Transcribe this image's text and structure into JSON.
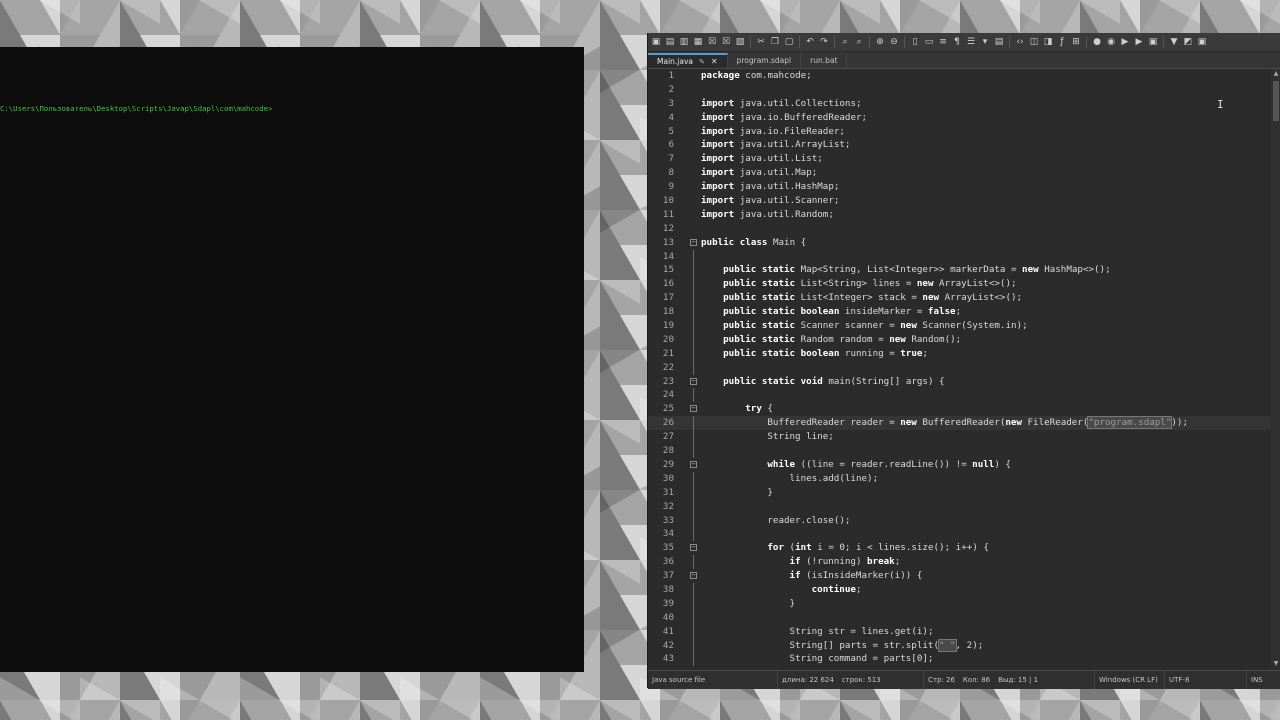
{
  "console": {
    "prompt": "C:\\Users\\Пользователь\\Desktop\\Scripts\\Javap\\Sdapl\\com\\mahcode>"
  },
  "editor": {
    "tabs": [
      {
        "label": "Main.java",
        "active": true
      },
      {
        "label": "program.sdapl",
        "active": false
      },
      {
        "label": "run.bat",
        "active": false
      }
    ],
    "lines": [
      {
        "n": "1",
        "text": "package com.mahcode;"
      },
      {
        "n": "2",
        "text": ""
      },
      {
        "n": "3",
        "text": "import java.util.Collections;"
      },
      {
        "n": "4",
        "text": "import java.io.BufferedReader;"
      },
      {
        "n": "5",
        "text": "import java.io.FileReader;"
      },
      {
        "n": "6",
        "text": "import java.util.ArrayList;"
      },
      {
        "n": "7",
        "text": "import java.util.List;"
      },
      {
        "n": "8",
        "text": "import java.util.Map;"
      },
      {
        "n": "9",
        "text": "import java.util.HashMap;"
      },
      {
        "n": "10",
        "text": "import java.util.Scanner;"
      },
      {
        "n": "11",
        "text": "import java.util.Random;"
      },
      {
        "n": "12",
        "text": ""
      },
      {
        "n": "13",
        "text": "public class Main {",
        "fold": true
      },
      {
        "n": "14",
        "text": ""
      },
      {
        "n": "15",
        "text": "    public static Map<String, List<Integer>> markerData = new HashMap<>();"
      },
      {
        "n": "16",
        "text": "    public static List<String> lines = new ArrayList<>();"
      },
      {
        "n": "17",
        "text": "    public static List<Integer> stack = new ArrayList<>();"
      },
      {
        "n": "18",
        "text": "    public static boolean insideMarker = false;"
      },
      {
        "n": "19",
        "text": "    public static Scanner scanner = new Scanner(System.in);"
      },
      {
        "n": "20",
        "text": "    public static Random random = new Random();"
      },
      {
        "n": "21",
        "text": "    public static boolean running = true;"
      },
      {
        "n": "22",
        "text": ""
      },
      {
        "n": "23",
        "text": "    public static void main(String[] args) {",
        "fold": true
      },
      {
        "n": "24",
        "text": ""
      },
      {
        "n": "25",
        "text": "        try {",
        "fold": true
      },
      {
        "n": "26",
        "text": "            BufferedReader reader = new BufferedReader(new FileReader(\"program.sdapl\"));",
        "current": true
      },
      {
        "n": "27",
        "text": "            String line;"
      },
      {
        "n": "28",
        "text": ""
      },
      {
        "n": "29",
        "text": "            while ((line = reader.readLine()) != null) {",
        "fold": true
      },
      {
        "n": "30",
        "text": "                lines.add(line);"
      },
      {
        "n": "31",
        "text": "            }"
      },
      {
        "n": "32",
        "text": ""
      },
      {
        "n": "33",
        "text": "            reader.close();"
      },
      {
        "n": "34",
        "text": ""
      },
      {
        "n": "35",
        "text": "            for (int i = 0; i < lines.size(); i++) {",
        "fold": true
      },
      {
        "n": "36",
        "text": "                if (!running) break;"
      },
      {
        "n": "37",
        "text": "                if (isInsideMarker(i)) {",
        "fold": true
      },
      {
        "n": "38",
        "text": "                    continue;"
      },
      {
        "n": "39",
        "text": "                }"
      },
      {
        "n": "40",
        "text": ""
      },
      {
        "n": "41",
        "text": "                String str = lines.get(i);"
      },
      {
        "n": "42",
        "text": "                String[] parts = str.split(\" \", 2);"
      },
      {
        "n": "43",
        "text": "                String command = parts[0];"
      }
    ],
    "keywords": [
      "package",
      "import",
      "public",
      "class",
      "static",
      "new",
      "boolean",
      "false",
      "true",
      "void",
      "try",
      "while",
      "null",
      "for",
      "int",
      "if",
      "break",
      "continue"
    ]
  },
  "statusbar": {
    "filetype": "Java source file",
    "length": "длина: 22 624",
    "lines": "строк: 513",
    "position": "Стр: 26",
    "column": "Кол: 86",
    "selection": "Выд: 15 | 1",
    "eol": "Windows (CR LF)",
    "encoding": "UTF-8",
    "mode": "INS"
  },
  "toolbar_icons": [
    "new-icon",
    "open-icon",
    "save-icon",
    "save-all-icon",
    "close-icon",
    "close-all-icon",
    "print-icon",
    "cut-icon",
    "copy-icon",
    "paste-icon",
    "undo-icon",
    "redo-icon",
    "find-icon",
    "replace-icon",
    "zoom-in-icon",
    "zoom-out-icon",
    "sync-v-icon",
    "sync-h-icon",
    "wrap-icon",
    "show-all-icon",
    "indent-guide-icon",
    "udl-icon",
    "doc-map-icon",
    "function-list-icon",
    "folder-workspace-icon",
    "monitor-icon",
    "record-icon",
    "stop-icon",
    "play-icon",
    "play-multi-icon",
    "save-macro-icon",
    "filter-icon",
    "highlight-icon",
    "terminal-icon"
  ]
}
